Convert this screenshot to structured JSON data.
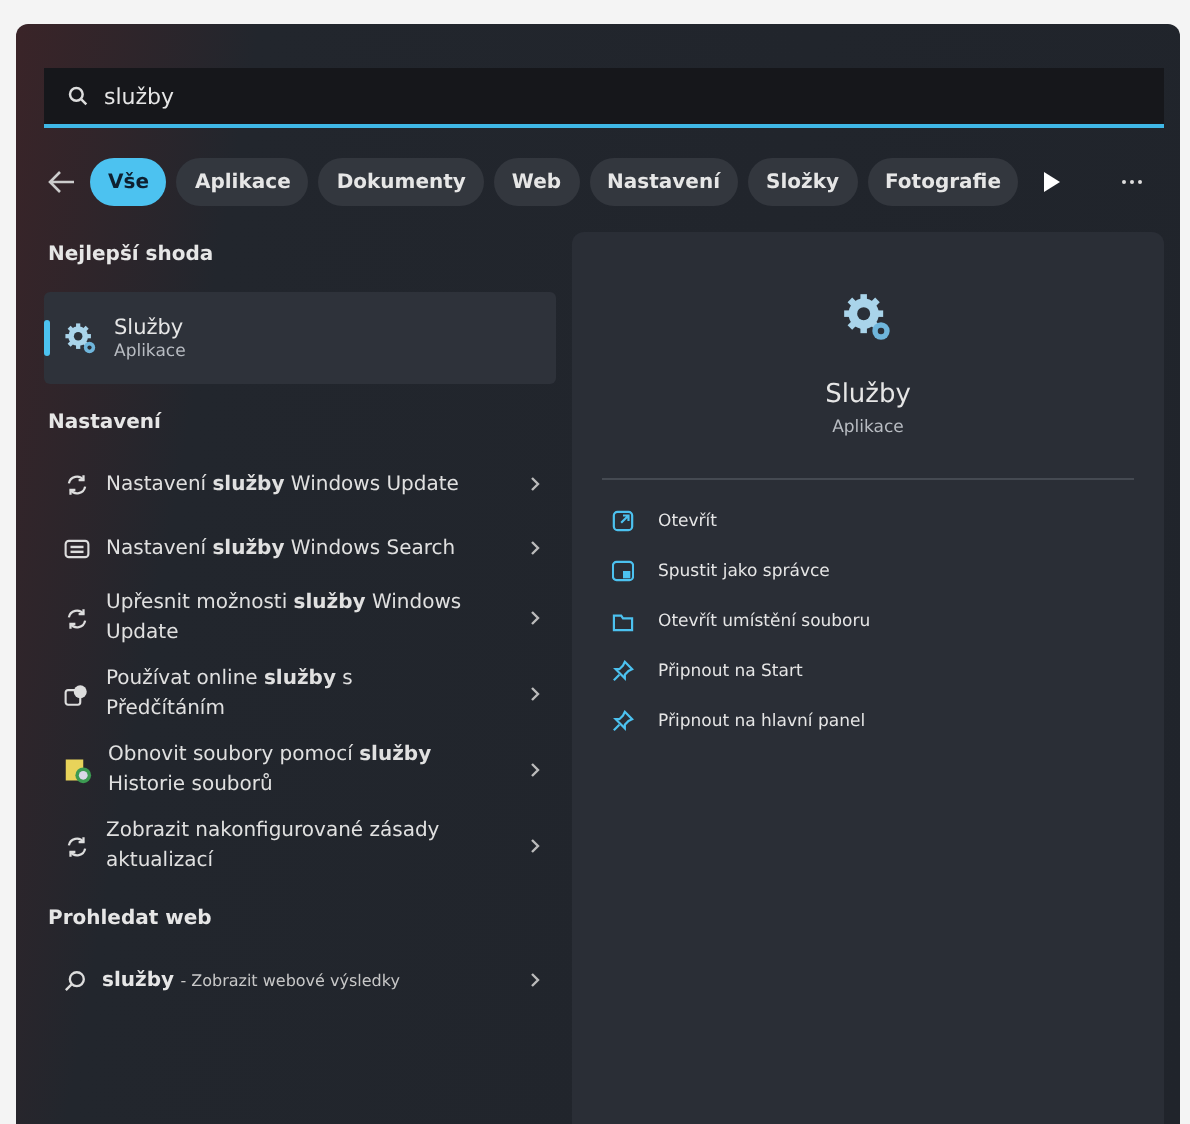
{
  "search": {
    "value": "služby"
  },
  "filters": [
    {
      "label": "Vše",
      "selected": true
    },
    {
      "label": "Aplikace",
      "selected": false
    },
    {
      "label": "Dokumenty",
      "selected": false
    },
    {
      "label": "Web",
      "selected": false
    },
    {
      "label": "Nastavení",
      "selected": false
    },
    {
      "label": "Složky",
      "selected": false
    },
    {
      "label": "Fotografie",
      "selected": false
    }
  ],
  "best_match": {
    "heading": "Nejlepší shoda",
    "title": "Služby",
    "subtitle": "Aplikace",
    "selected": true
  },
  "settings": {
    "heading": "Nastavení",
    "items": [
      {
        "kind": "sync",
        "text": "Nastavení **služby** Windows Update"
      },
      {
        "kind": "search-settings",
        "text": "Nastavení **služby** Windows Search"
      },
      {
        "kind": "sync",
        "text": "Upřesnit možnosti **služby** Windows Update"
      },
      {
        "kind": "speech",
        "text": "Používat online **služby** s Předčítáním"
      },
      {
        "kind": "history",
        "text": "Obnovit soubory pomocí **služby** Historie souborů"
      },
      {
        "kind": "sync",
        "text": "Zobrazit nakonfigurované zásady aktualizací"
      }
    ]
  },
  "web": {
    "heading": "Prohledat web",
    "query": "služby",
    "suffix": "- Zobrazit webové výsledky"
  },
  "detail": {
    "title": "Služby",
    "subtitle": "Aplikace",
    "actions": [
      {
        "kind": "open",
        "label": "Otevřít"
      },
      {
        "kind": "admin",
        "label": "Spustit jako správce"
      },
      {
        "kind": "folder",
        "label": "Otevřít umístění souboru"
      },
      {
        "kind": "pin",
        "label": "Připnout na Start"
      },
      {
        "kind": "pin",
        "label": "Připnout na hlavní panel"
      }
    ]
  }
}
